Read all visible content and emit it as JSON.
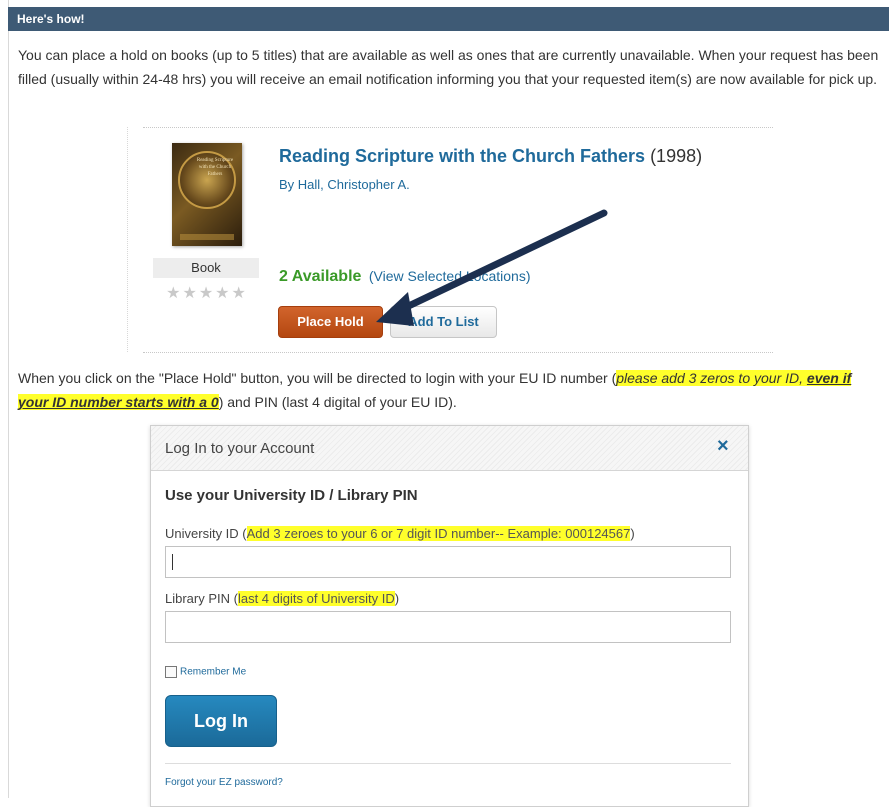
{
  "header": {
    "title": "Here's how!"
  },
  "intro": {
    "text": "You can place a hold on books (up to 5 titles) that are available as well as ones that are currently unavailable. When your request has been filled (usually within 24-48 hrs) you will receive an email notification informing you that your requested item(s) are now available for pick up."
  },
  "book": {
    "title": "Reading Scripture with the Church Fathers",
    "year": "(1998)",
    "author": "By Hall, Christopher A.",
    "cover_text": "Reading Scripture with the Church Fathers",
    "cover_author": "Christopher A. Hall",
    "format": "Book",
    "stars": "★★★★★",
    "available_count": "2 Available",
    "available_link": "(View Selected Locations)",
    "place_hold_label": "Place Hold",
    "add_list_label": "Add To List"
  },
  "instructions": {
    "before": "When you click on the \"Place Hold\" button, you will be directed to login with your EU ID number (",
    "highlight": "please add 3 zeros to your ID, ",
    "highlight_bold": "even if your ID number starts with a 0",
    "after": ") and PIN (last 4 digital of your EU ID)."
  },
  "dialog": {
    "title": "Log In to your Account",
    "close_glyph": "×",
    "heading": "Use your University ID / Library PIN",
    "id_label": "University ID (",
    "id_hint": "Add 3 zeroes to your 6 or 7 digit ID number-- Example: 000124567",
    "id_label_end": ")",
    "pin_label": "Library PIN (",
    "pin_hint": "last 4 digits of University ID",
    "pin_label_end": ")",
    "remember_label": "Remember Me",
    "login_label": "Log In",
    "forgot_label": "Forgot your EZ password?"
  },
  "colors": {
    "header_bg": "#3e5a75",
    "link": "#1f6a9b",
    "available": "#3a9a28",
    "place_hold": "#c4531c",
    "highlight": "#ffff2b",
    "arrow": "#1c2f4f"
  },
  "icons": {
    "close": "close-icon",
    "arrow": "annotation-arrow"
  }
}
